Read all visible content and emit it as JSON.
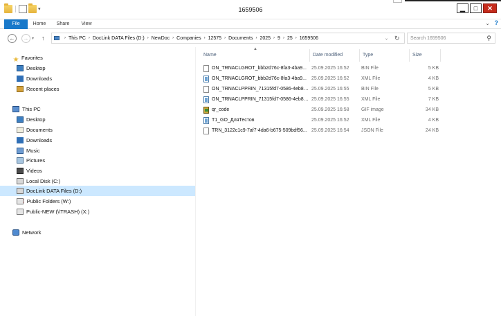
{
  "window": {
    "title": "1659506"
  },
  "ribbon": {
    "tabs": [
      "File",
      "Home",
      "Share",
      "View"
    ]
  },
  "address": {
    "crumbs": [
      "This PC",
      "DocLink DATA Files (D:)",
      "NewDoc",
      "Companies",
      "12575",
      "Documents",
      "2025",
      "9",
      "25",
      "1659506"
    ]
  },
  "search": {
    "placeholder": "Search 1659506"
  },
  "navpane": {
    "favorites_label": "Favorites",
    "favorites": [
      "Desktop",
      "Downloads",
      "Recent places"
    ],
    "thispc_label": "This PC",
    "thispc": [
      "Desktop",
      "Documents",
      "Downloads",
      "Music",
      "Pictures",
      "Videos",
      "Local Disk (C:)",
      "DocLink DATA Files (D:)",
      "Public Folders (W:)",
      "Public-NEW (\\\\TRASH) (X:)"
    ],
    "network_label": "Network"
  },
  "columns": {
    "name": "Name",
    "date": "Date modified",
    "type": "Type",
    "size": "Size"
  },
  "files": [
    {
      "name": "ON_TRNACLGROT_bbb2d76c-8fa3-4ba9...",
      "date": "25.09.2025 16:52",
      "type": "BIN File",
      "size": "5 KB",
      "icon": "bin-file-icon"
    },
    {
      "name": "ON_TRNACLGROT_bbb2d76c-8fa3-4ba9...",
      "date": "25.09.2025 16:52",
      "type": "XML File",
      "size": "4 KB",
      "icon": "xml-file-icon"
    },
    {
      "name": "ON_TRNACLPPRIN_71315fd7-0586-4eb8-...",
      "date": "25.09.2025 16:55",
      "type": "BIN File",
      "size": "5 KB",
      "icon": "bin-file-icon"
    },
    {
      "name": "ON_TRNACLPPRIN_71315fd7-0586-4eb8-...",
      "date": "25.09.2025 16:55",
      "type": "XML File",
      "size": "7 KB",
      "icon": "xml-file-icon"
    },
    {
      "name": "qr_code",
      "date": "25.09.2025 16:58",
      "type": "GIF image",
      "size": "34 KB",
      "icon": "gif-file-icon"
    },
    {
      "name": "T1_GO_ДляТестов",
      "date": "25.09.2025 16:52",
      "type": "XML File",
      "size": "4 KB",
      "icon": "xml-file-icon"
    },
    {
      "name": "TRN_3122c1c9-7af7-4da6-b675-509bdf56...",
      "date": "25.09.2025 16:54",
      "type": "JSON File",
      "size": "24 KB",
      "icon": "json-file-icon"
    }
  ]
}
